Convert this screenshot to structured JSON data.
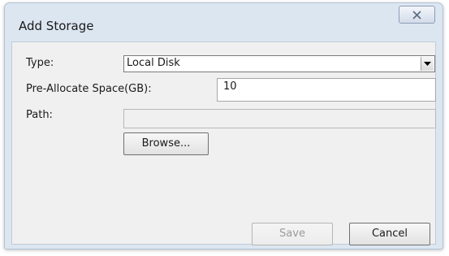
{
  "dialog": {
    "title": "Add Storage",
    "close_icon": "close-x-icon"
  },
  "form": {
    "type_label": "Type:",
    "type_value": "Local Disk",
    "preallocate_label": "Pre-Allocate Space(GB):",
    "preallocate_value": "10",
    "path_label": "Path:",
    "path_value": ""
  },
  "buttons": {
    "browse": "Browse...",
    "save": "Save",
    "cancel": "Cancel"
  },
  "colors": {
    "frame": "#dce6f1",
    "client": "#f0f0f0",
    "disabled_text": "#9a9a9a"
  }
}
